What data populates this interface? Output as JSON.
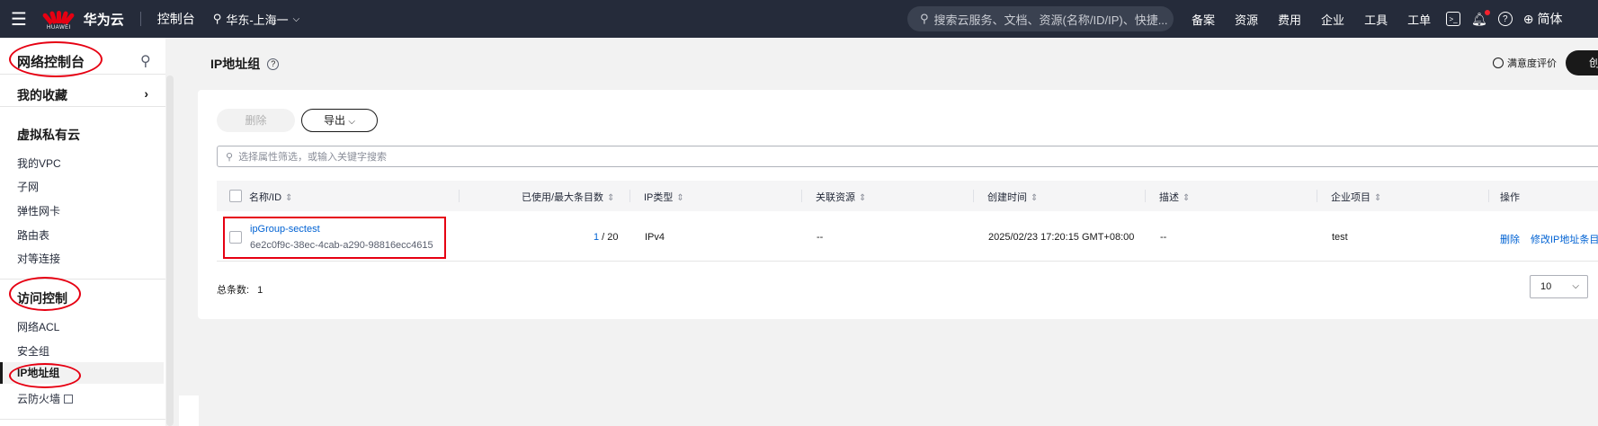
{
  "topbar": {
    "menu_icon": "hamburger-icon",
    "logo_text": "HUAWEI",
    "brand": "华为云",
    "console": "控制台",
    "region": "华东-上海一",
    "search_placeholder": "搜索云服务、文档、资源(名称/ID/IP)、快捷...",
    "nav": [
      "备案",
      "资源",
      "费用",
      "企业",
      "工具",
      "工单"
    ],
    "lang": "简体"
  },
  "sidebar": {
    "title": "网络控制台",
    "favorites": "我的收藏",
    "groups": [
      {
        "label": "虚拟私有云",
        "items": [
          "我的VPC",
          "子网",
          "弹性网卡",
          "路由表",
          "对等连接"
        ]
      },
      {
        "label": "访问控制",
        "items": [
          "网络ACL",
          "安全组",
          "IP地址组",
          "云防火墙"
        ]
      }
    ],
    "active_item": "IP地址组"
  },
  "main": {
    "title": "IP地址组",
    "satisfaction": "满意度评价",
    "create_btn": "创",
    "delete_btn": "删除",
    "export_btn": "导出",
    "filter_placeholder": "选择属性筛选，或输入关键字搜索"
  },
  "table": {
    "headers": [
      "名称/ID",
      "已使用/最大条目数",
      "IP类型",
      "关联资源",
      "创建时间",
      "描述",
      "企业项目",
      "操作"
    ],
    "rows": [
      {
        "name": "ipGroup-sectest",
        "id": "6e2c0f9c-38ec-4cab-a290-98816ecc4615",
        "used": "1",
        "max": " / 20",
        "ip_type": "IPv4",
        "resources": "--",
        "created": "2025/02/23 17:20:15 GMT+08:00",
        "description": "--",
        "project": "test",
        "action_delete": "删除",
        "action_modify": "修改IP地址条目"
      }
    ],
    "total_label": "总条数:",
    "total": "1",
    "page_size": "10"
  },
  "colors": {
    "topbar": "#252b3a",
    "link": "#0062d3",
    "annotation": "#e60012"
  }
}
